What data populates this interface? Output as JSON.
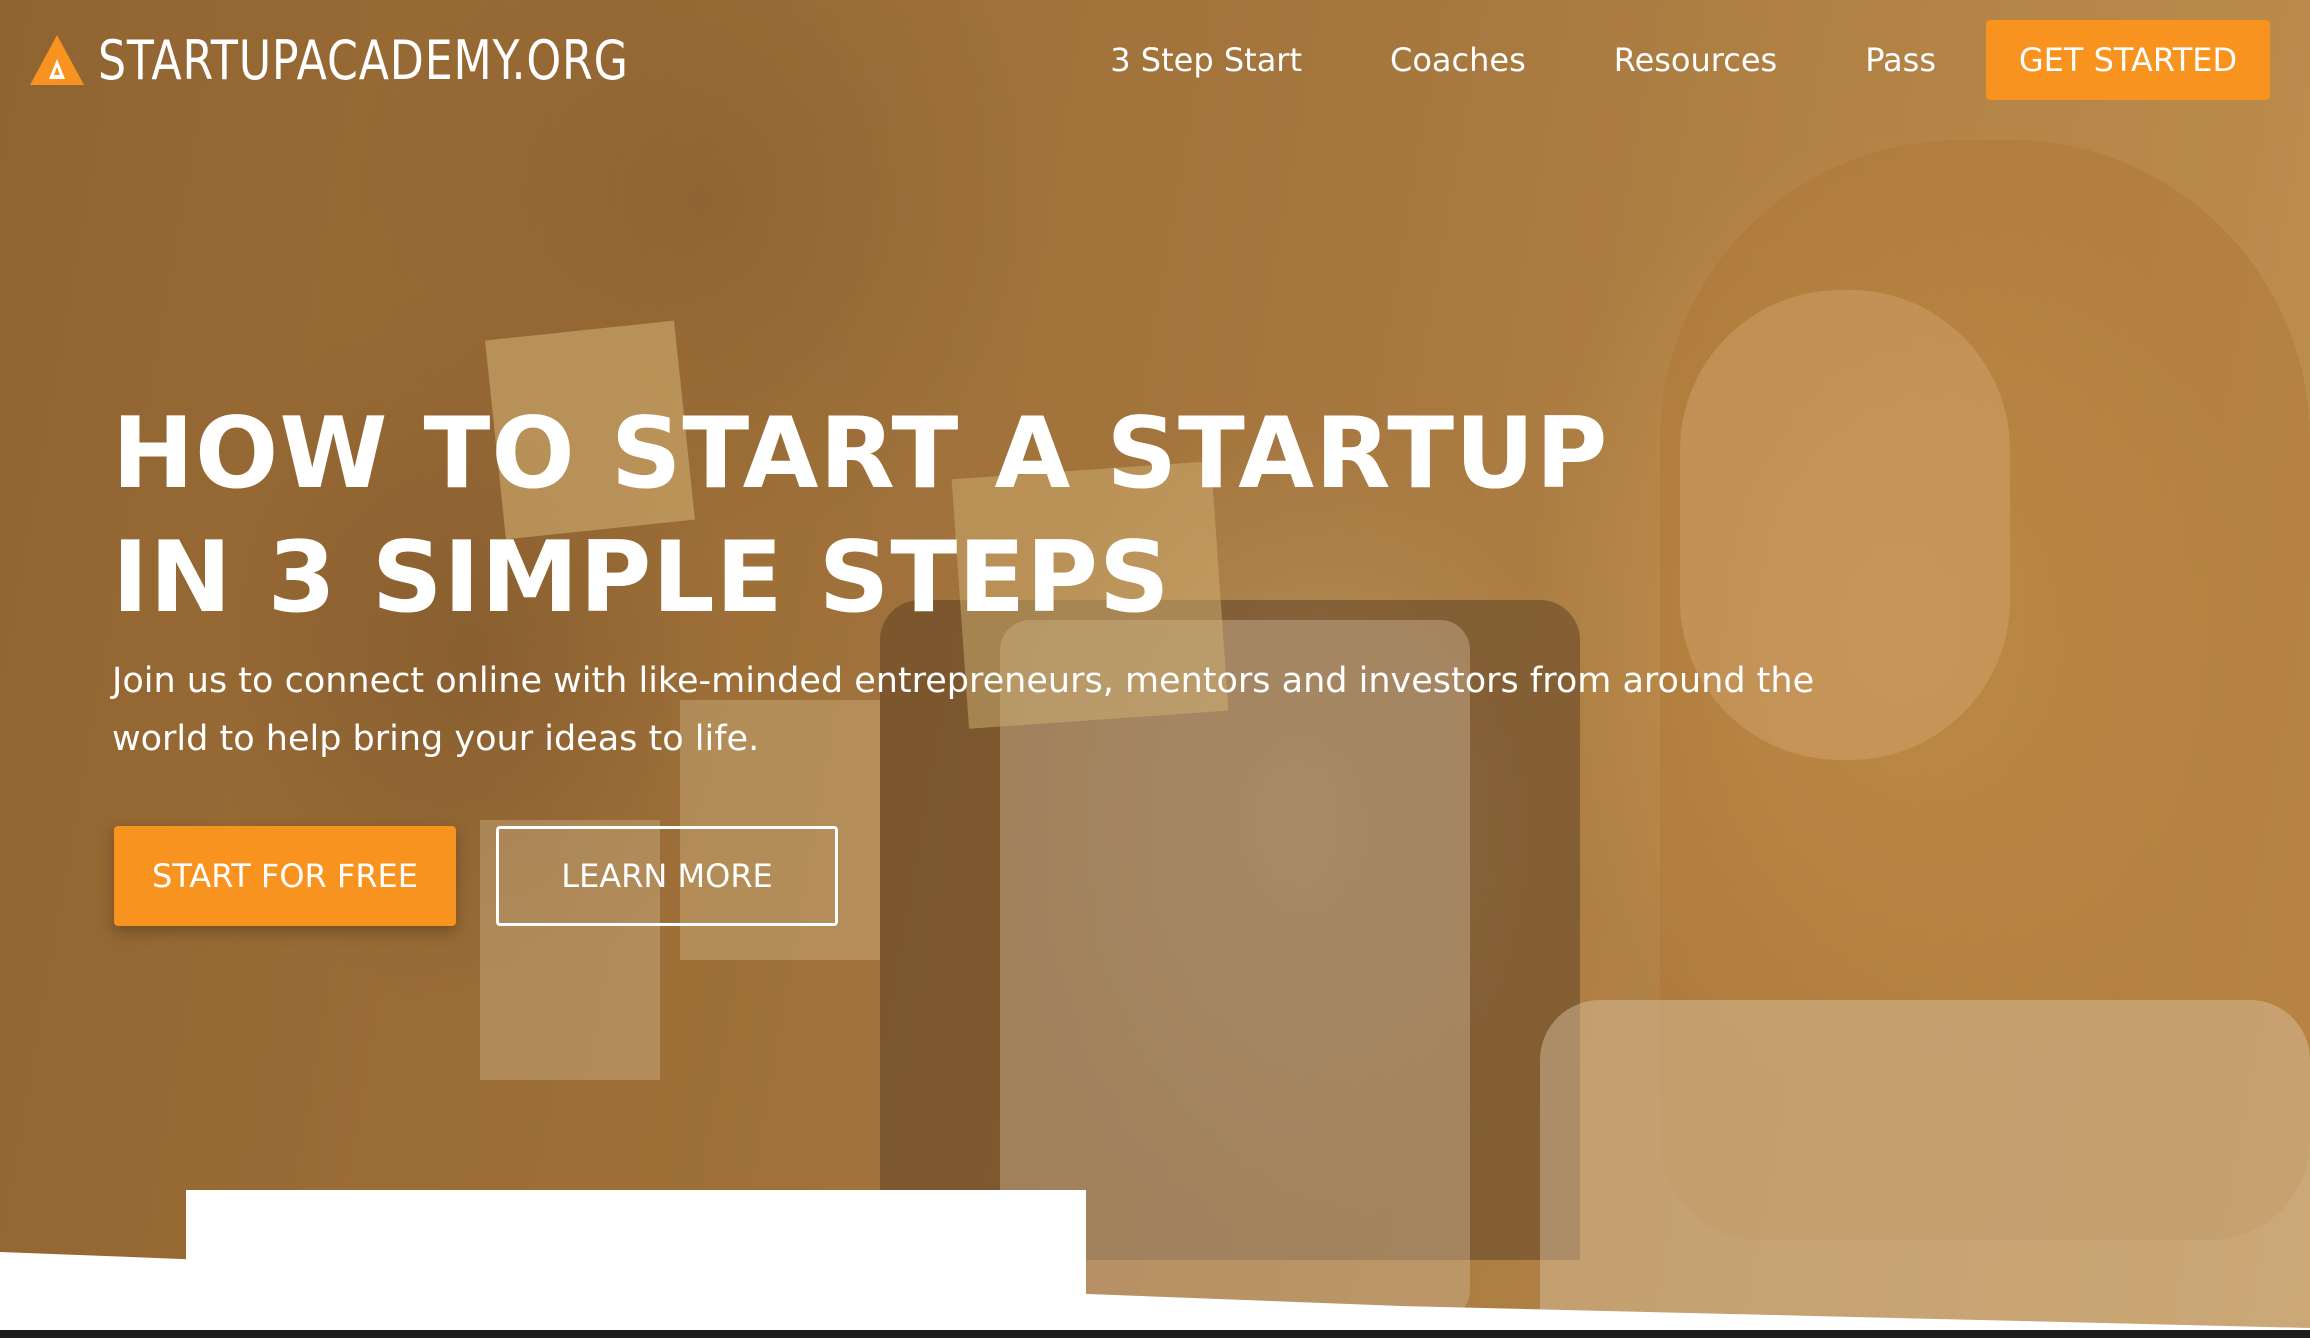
{
  "brand": {
    "name": "STARTUPACADEMY.ORG",
    "accent_color": "#f7931e",
    "logo_icon": "triangle-a-logo-icon"
  },
  "nav": {
    "links": [
      {
        "label": "3 Step Start"
      },
      {
        "label": "Coaches"
      },
      {
        "label": "Resources"
      },
      {
        "label": "Pass"
      }
    ],
    "cta_label": "GET STARTED"
  },
  "hero": {
    "headline_line1": "HOW TO START A STARTUP",
    "headline_line2": "IN 3 SIMPLE STEPS",
    "subtext": "Join us to connect online with like-minded entrepreneurs, mentors and investors from around the world to help bring your ideas to life.",
    "primary_button": "START FOR FREE",
    "secondary_button": "LEARN MORE",
    "overlay_color": "#b07a3a"
  }
}
